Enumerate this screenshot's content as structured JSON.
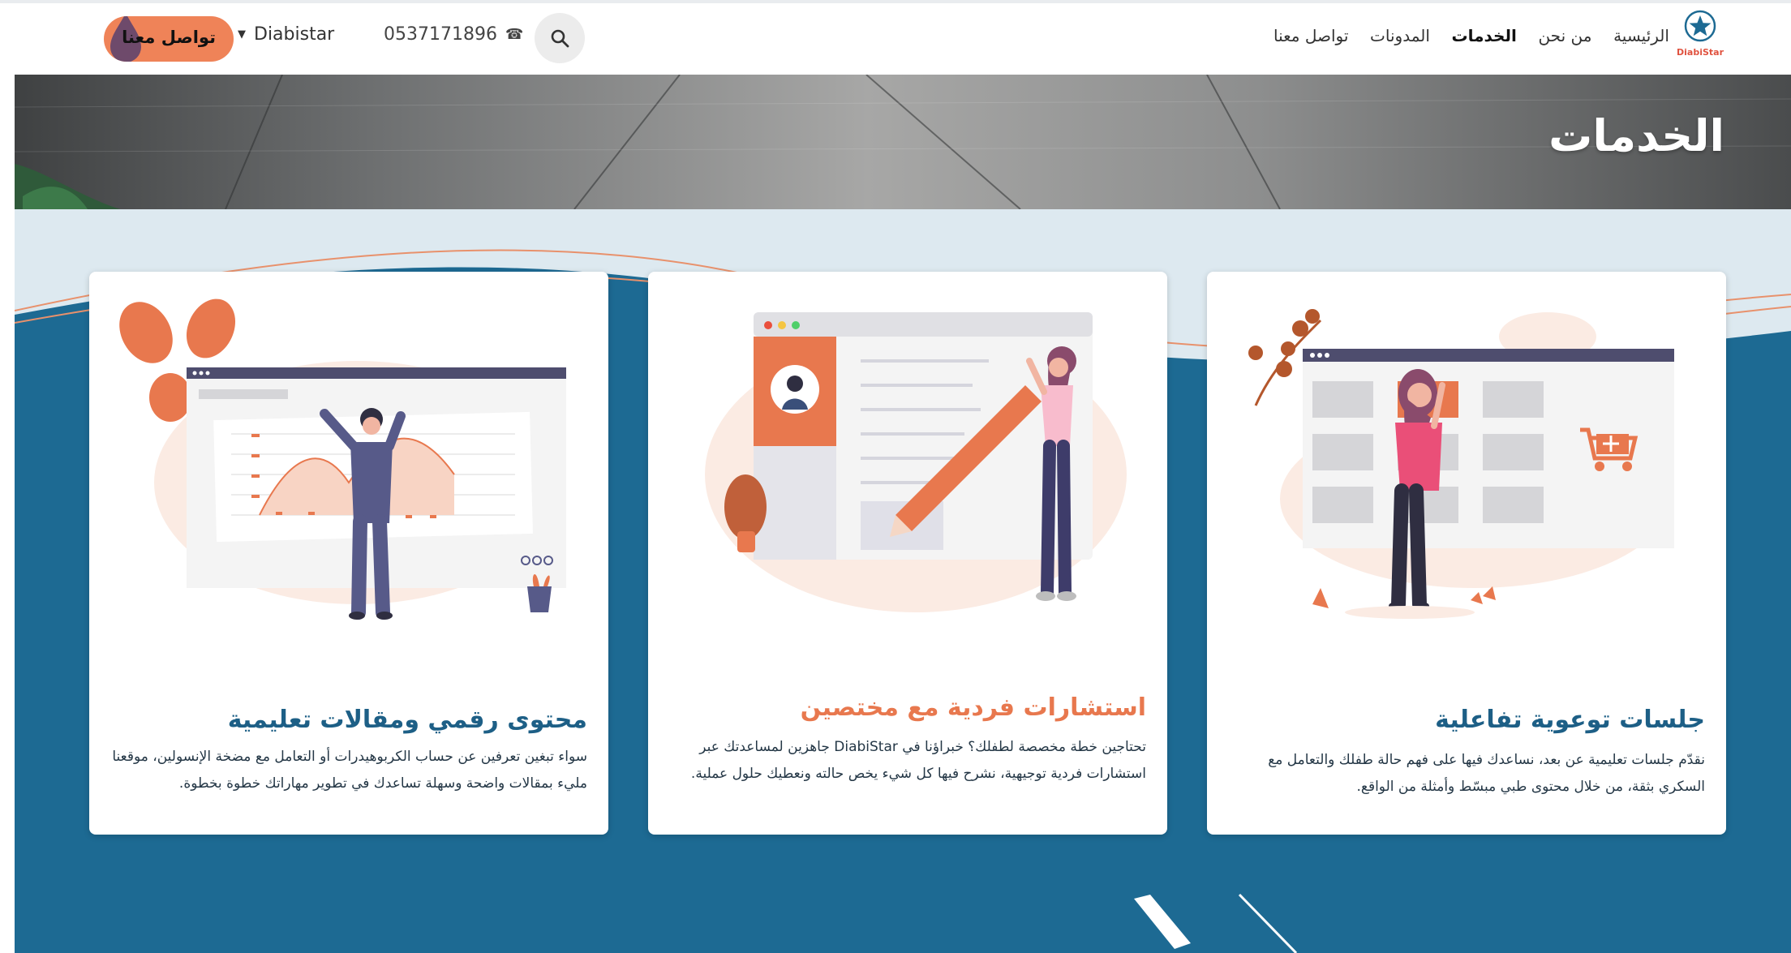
{
  "header": {
    "cta_label": "تواصل معنا",
    "brand": "Diabistar",
    "phone": "0537171896",
    "nav": [
      "الرئيسية",
      "من نحن",
      "الخدمات",
      "المدونات",
      "تواصل معنا"
    ],
    "active_nav": "الخدمات",
    "logo_text": "DiabiStar"
  },
  "banner": {
    "title": "الخدمات"
  },
  "cards": [
    {
      "title": "جلسات توعوية تفاعلية",
      "description": "نقدّم جلسات تعليمية عن بعد، نساعدك فيها على فهم حالة طفلك والتعامل مع السكري بثقة، من خلال محتوى طبي مبسّط وأمثلة من الواقع.",
      "title_color": "#1d5f86"
    },
    {
      "title": "استشارات فردية مع مختصين",
      "description": "تحتاجين خطة مخصصة لطفلك؟ خبراؤنا في DiabiStar جاهزين لمساعدتك عبر استشارات فردية توجيهية، نشرح فيها كل شيء يخص حالته ونعطيك حلول عملية.",
      "title_color": "#e8784e"
    },
    {
      "title": "محتوى رقمي ومقالات تعليمية",
      "description": "سواء تبغين تعرفين عن حساب الكربوهيدرات أو التعامل مع مضخة الإنسولين، موقعنا مليء بمقالات واضحة وسهلة تساعدك في تطوير مهاراتك خطوة بخطوة.",
      "title_color": "#1d5f86"
    }
  ],
  "colors": {
    "accent": "#ef8358",
    "section_blue": "#1d6a93",
    "title_blue": "#1d5f86",
    "title_orange": "#e8784e"
  }
}
